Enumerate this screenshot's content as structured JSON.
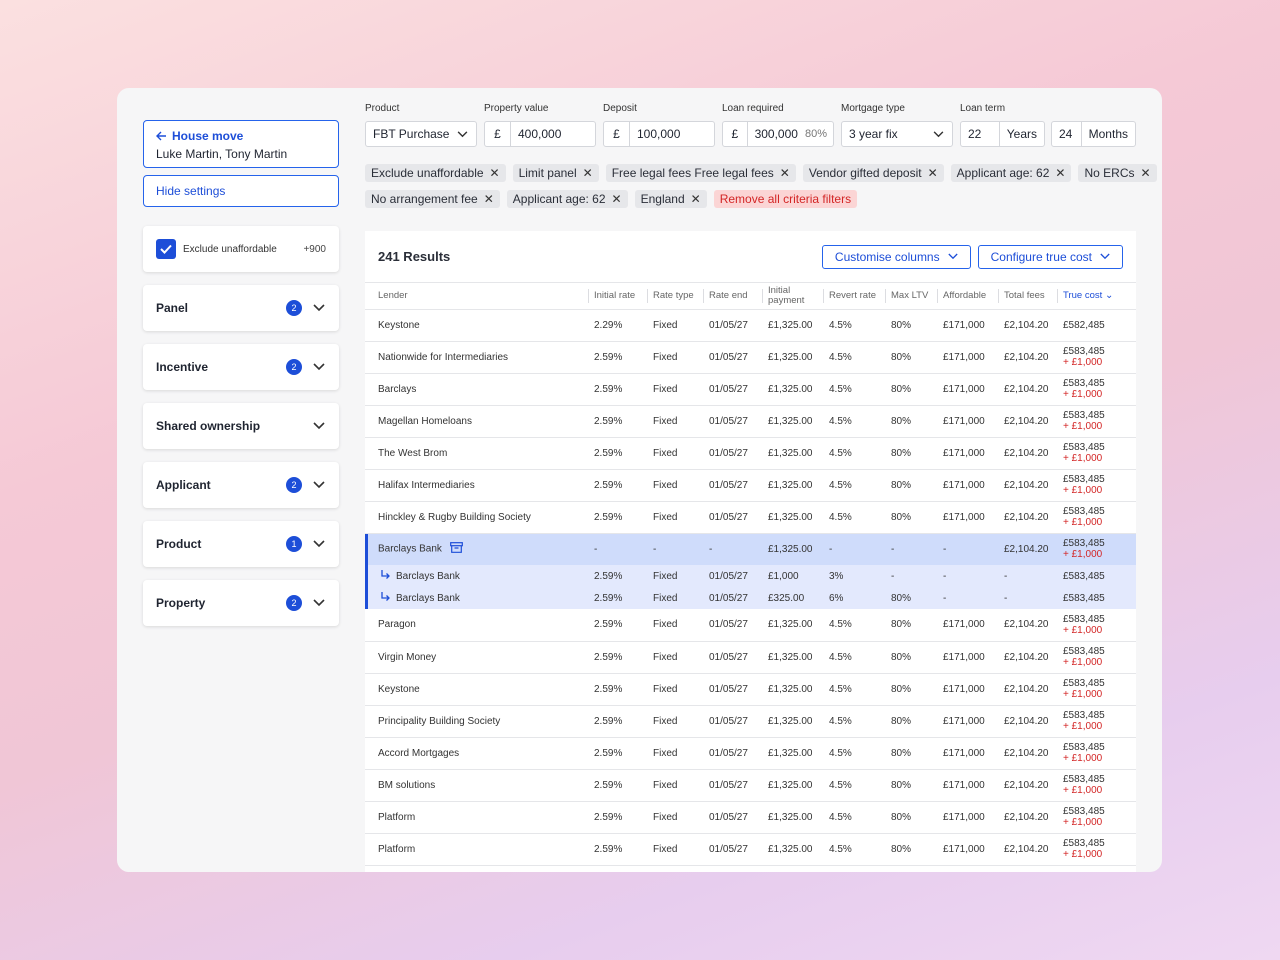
{
  "sidebar": {
    "house_title": "House move",
    "house_names": "Luke Martin, Tony Martin",
    "hide_settings": "Hide settings",
    "exclude_label": "Exclude unaffordable",
    "exclude_count": "+900",
    "filters": [
      {
        "label": "Panel",
        "badge": "2"
      },
      {
        "label": "Incentive",
        "badge": "2"
      },
      {
        "label": "Shared ownership",
        "badge": ""
      },
      {
        "label": "Applicant",
        "badge": "2"
      },
      {
        "label": "Product",
        "badge": "1"
      },
      {
        "label": "Property",
        "badge": "2"
      }
    ]
  },
  "fields": {
    "product": {
      "label": "Product",
      "value": "FBT Purchase"
    },
    "property_value": {
      "label": "Property value",
      "prefix": "£",
      "value": "400,000"
    },
    "deposit": {
      "label": "Deposit",
      "prefix": "£",
      "value": "100,000"
    },
    "loan_required": {
      "label": "Loan required",
      "prefix": "£",
      "value": "300,000",
      "pct": "80%"
    },
    "mortgage_type": {
      "label": "Mortgage type",
      "value": "3 year fix"
    },
    "loan_term": {
      "label": "Loan term",
      "years": "22",
      "years_unit": "Years",
      "months": "24",
      "months_unit": "Months"
    }
  },
  "chips_row1": [
    "Exclude unaffordable",
    "Limit panel",
    "Free legal fees Free legal fees",
    "Vendor gifted deposit",
    "Applicant age: 62",
    "No ERCs"
  ],
  "chips_row2": [
    "No arrangement fee",
    "Applicant age: 62",
    "England"
  ],
  "remove_all": "Remove all criteria filters",
  "results": {
    "title": "241 Results",
    "customise": "Customise columns",
    "configure": "Configure true cost",
    "columns": [
      "Lender",
      "Initial rate",
      "Rate type",
      "Rate end",
      "Initial payment",
      "Revert rate",
      "Max LTV",
      "Affordable",
      "Total fees",
      "True cost"
    ],
    "rows": [
      {
        "lender": "Keystone",
        "rate": "2.29%",
        "type": "Fixed",
        "end": "01/05/27",
        "payment": "£1,325.00",
        "revert": "4.5%",
        "ltv": "80%",
        "afford": "£171,000",
        "fees": "£2,104.20",
        "cost": "£582,485",
        "plus": ""
      },
      {
        "lender": "Nationwide for Intermediaries",
        "rate": "2.59%",
        "type": "Fixed",
        "end": "01/05/27",
        "payment": "£1,325.00",
        "revert": "4.5%",
        "ltv": "80%",
        "afford": "£171,000",
        "fees": "£2,104.20",
        "cost": "£583,485",
        "plus": "+ £1,000"
      },
      {
        "lender": "Barclays",
        "rate": "2.59%",
        "type": "Fixed",
        "end": "01/05/27",
        "payment": "£1,325.00",
        "revert": "4.5%",
        "ltv": "80%",
        "afford": "£171,000",
        "fees": "£2,104.20",
        "cost": "£583,485",
        "plus": "+ £1,000"
      },
      {
        "lender": "Magellan Homeloans",
        "rate": "2.59%",
        "type": "Fixed",
        "end": "01/05/27",
        "payment": "£1,325.00",
        "revert": "4.5%",
        "ltv": "80%",
        "afford": "£171,000",
        "fees": "£2,104.20",
        "cost": "£583,485",
        "plus": "+ £1,000"
      },
      {
        "lender": "The West Brom",
        "rate": "2.59%",
        "type": "Fixed",
        "end": "01/05/27",
        "payment": "£1,325.00",
        "revert": "4.5%",
        "ltv": "80%",
        "afford": "£171,000",
        "fees": "£2,104.20",
        "cost": "£583,485",
        "plus": "+ £1,000"
      },
      {
        "lender": "Halifax Intermediaries",
        "rate": "2.59%",
        "type": "Fixed",
        "end": "01/05/27",
        "payment": "£1,325.00",
        "revert": "4.5%",
        "ltv": "80%",
        "afford": "£171,000",
        "fees": "£2,104.20",
        "cost": "£583,485",
        "plus": "+ £1,000"
      },
      {
        "lender": "Hinckley & Rugby Building Society",
        "rate": "2.59%",
        "type": "Fixed",
        "end": "01/05/27",
        "payment": "£1,325.00",
        "revert": "4.5%",
        "ltv": "80%",
        "afford": "£171,000",
        "fees": "£2,104.20",
        "cost": "£583,485",
        "plus": "+ £1,000"
      }
    ],
    "group": {
      "lender": "Barclays Bank",
      "rate": "-",
      "type": "-",
      "end": "-",
      "payment": "£1,325.00",
      "revert": "-",
      "ltv": "-",
      "afford": "-",
      "fees": "£2,104.20",
      "cost": "£583,485",
      "plus": "+ £1,000"
    },
    "subrows": [
      {
        "lender": "Barclays Bank",
        "rate": "2.59%",
        "type": "Fixed",
        "end": "01/05/27",
        "payment": "£1,000",
        "revert": "3%",
        "ltv": "-",
        "afford": "-",
        "fees": "-",
        "cost": "£583,485"
      },
      {
        "lender": "Barclays Bank",
        "rate": "2.59%",
        "type": "Fixed",
        "end": "01/05/27",
        "payment": "£325.00",
        "revert": "6%",
        "ltv": "80%",
        "afford": "-",
        "fees": "-",
        "cost": "£583,485"
      }
    ],
    "rows2": [
      {
        "lender": "Paragon",
        "rate": "2.59%",
        "type": "Fixed",
        "end": "01/05/27",
        "payment": "£1,325.00",
        "revert": "4.5%",
        "ltv": "80%",
        "afford": "£171,000",
        "fees": "£2,104.20",
        "cost": "£583,485",
        "plus": "+ £1,000"
      },
      {
        "lender": "Virgin Money",
        "rate": "2.59%",
        "type": "Fixed",
        "end": "01/05/27",
        "payment": "£1,325.00",
        "revert": "4.5%",
        "ltv": "80%",
        "afford": "£171,000",
        "fees": "£2,104.20",
        "cost": "£583,485",
        "plus": "+ £1,000"
      },
      {
        "lender": "Keystone",
        "rate": "2.59%",
        "type": "Fixed",
        "end": "01/05/27",
        "payment": "£1,325.00",
        "revert": "4.5%",
        "ltv": "80%",
        "afford": "£171,000",
        "fees": "£2,104.20",
        "cost": "£583,485",
        "plus": "+ £1,000"
      },
      {
        "lender": "Principality Building Society",
        "rate": "2.59%",
        "type": "Fixed",
        "end": "01/05/27",
        "payment": "£1,325.00",
        "revert": "4.5%",
        "ltv": "80%",
        "afford": "£171,000",
        "fees": "£2,104.20",
        "cost": "£583,485",
        "plus": "+ £1,000"
      },
      {
        "lender": "Accord Mortgages",
        "rate": "2.59%",
        "type": "Fixed",
        "end": "01/05/27",
        "payment": "£1,325.00",
        "revert": "4.5%",
        "ltv": "80%",
        "afford": "£171,000",
        "fees": "£2,104.20",
        "cost": "£583,485",
        "plus": "+ £1,000"
      },
      {
        "lender": "BM solutions",
        "rate": "2.59%",
        "type": "Fixed",
        "end": "01/05/27",
        "payment": "£1,325.00",
        "revert": "4.5%",
        "ltv": "80%",
        "afford": "£171,000",
        "fees": "£2,104.20",
        "cost": "£583,485",
        "plus": "+ £1,000"
      },
      {
        "lender": "Platform",
        "rate": "2.59%",
        "type": "Fixed",
        "end": "01/05/27",
        "payment": "£1,325.00",
        "revert": "4.5%",
        "ltv": "80%",
        "afford": "£171,000",
        "fees": "£2,104.20",
        "cost": "£583,485",
        "plus": "+ £1,000"
      },
      {
        "lender": "Platform",
        "rate": "2.59%",
        "type": "Fixed",
        "end": "01/05/27",
        "payment": "£1,325.00",
        "revert": "4.5%",
        "ltv": "80%",
        "afford": "£171,000",
        "fees": "£2,104.20",
        "cost": "£583,485",
        "plus": "+ £1,000"
      }
    ]
  },
  "colors": {
    "accent": "#1d4ed8",
    "danger": "#d32626",
    "highlight": "#cfdcfb"
  }
}
